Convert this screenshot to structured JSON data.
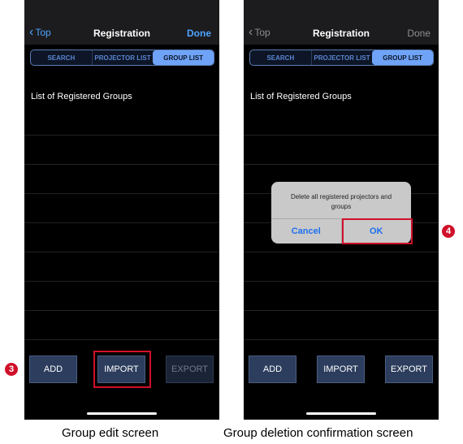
{
  "screens": [
    {
      "nav": {
        "back_label": "Top",
        "title": "Registration",
        "done_label": "Done",
        "done_enabled": true
      },
      "segments": [
        "SEARCH",
        "PROJECTOR LIST",
        "GROUP LIST"
      ],
      "active_segment": "GROUP LIST",
      "list_title": "List of Registered Groups",
      "buttons": {
        "add": "ADD",
        "import": "IMPORT",
        "export": "EXPORT"
      },
      "export_enabled": false,
      "step_marker": "3",
      "caption": "Group edit screen"
    },
    {
      "nav": {
        "back_label": "Top",
        "title": "Registration",
        "done_label": "Done",
        "done_enabled": false
      },
      "segments": [
        "SEARCH",
        "PROJECTOR LIST",
        "GROUP LIST"
      ],
      "active_segment": "GROUP LIST",
      "list_title": "List of Registered Groups",
      "buttons": {
        "add": "ADD",
        "import": "IMPORT",
        "export": "EXPORT"
      },
      "export_enabled": true,
      "dialog": {
        "message": "Delete all registered projectors and groups",
        "cancel": "Cancel",
        "ok": "OK"
      },
      "step_marker": "4",
      "caption": "Group deletion confirmation screen"
    }
  ],
  "colors": {
    "accent": "#4da3ff",
    "highlight": "#d0102a",
    "button_bg": "#2c3d5d"
  }
}
